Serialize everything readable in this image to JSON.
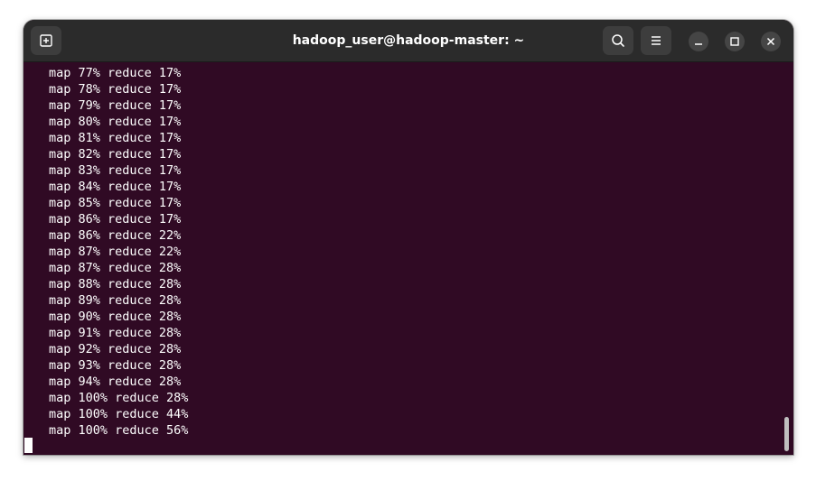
{
  "window": {
    "title": "hadoop_user@hadoop-master: ~"
  },
  "titlebar": {
    "icons": {
      "new_tab": "new-tab-icon",
      "search": "search-icon",
      "menu": "hamburger-menu-icon",
      "minimize": "minimize-icon",
      "maximize": "maximize-icon",
      "close": "close-icon"
    }
  },
  "terminal": {
    "lines": [
      "map 77% reduce 17%",
      "map 78% reduce 17%",
      "map 79% reduce 17%",
      "map 80% reduce 17%",
      "map 81% reduce 17%",
      "map 82% reduce 17%",
      "map 83% reduce 17%",
      "map 84% reduce 17%",
      "map 85% reduce 17%",
      "map 86% reduce 17%",
      "map 86% reduce 22%",
      "map 87% reduce 22%",
      "map 87% reduce 28%",
      "map 88% reduce 28%",
      "map 89% reduce 28%",
      "map 90% reduce 28%",
      "map 91% reduce 28%",
      "map 92% reduce 28%",
      "map 93% reduce 28%",
      "map 94% reduce 28%",
      "map 100% reduce 28%",
      "map 100% reduce 44%",
      "map 100% reduce 56%"
    ]
  },
  "colors": {
    "terminal_bg": "#300a24",
    "titlebar_bg": "#2b2b2b",
    "text": "#ffffff"
  }
}
